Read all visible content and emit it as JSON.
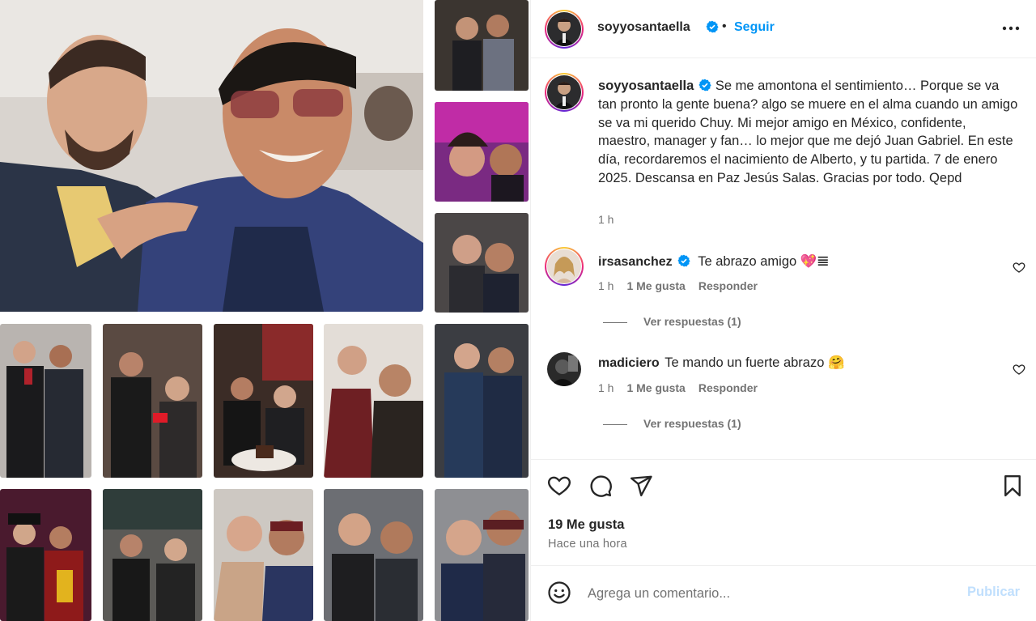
{
  "post": {
    "author": "soyyosantaella",
    "follow_label": "Seguir",
    "separator": "•",
    "caption": "Se me amontona el sentimiento… Porque se va tan pronto la gente buena? algo se muere en el alma cuando un amigo se va mi querido Chuy. Mi mejor amigo en México, confidente, maestro, manager y fan… lo mejor que me dejó Juan Gabriel. En este día, recordaremos el nacimiento de Alberto, y tu partida. 7 de enero 2025. Descansa en Paz Jesús Salas. Gracias por todo. Qepd",
    "caption_time": "1 h",
    "likes": "19 Me gusta",
    "time_ago": "Hace una hora"
  },
  "comments": [
    {
      "user": "irsasanchez",
      "text": "Te abrazo amigo 💖𝌆",
      "time": "1 h",
      "likes": "1 Me gusta",
      "reply_label": "Responder",
      "view_replies": "Ver respuestas (1)"
    },
    {
      "user": "madiciero",
      "text": "Te mando un fuerte abrazo 🤗",
      "time": "1 h",
      "likes": "1 Me gusta",
      "reply_label": "Responder",
      "view_replies": "Ver respuestas (1)"
    }
  ],
  "composer": {
    "placeholder": "Agrega un comentario...",
    "publish_label": "Publicar"
  },
  "icons": {
    "verified": "verified-badge-icon",
    "more": "more-options-icon",
    "like": "heart-icon",
    "comment": "comment-icon",
    "share": "share-icon",
    "save": "bookmark-icon",
    "emoji": "emoji-icon"
  },
  "colors": {
    "accent": "#0095f6",
    "text": "#262626",
    "secondary": "#737373",
    "publish_disabled": "#c0dffd"
  }
}
